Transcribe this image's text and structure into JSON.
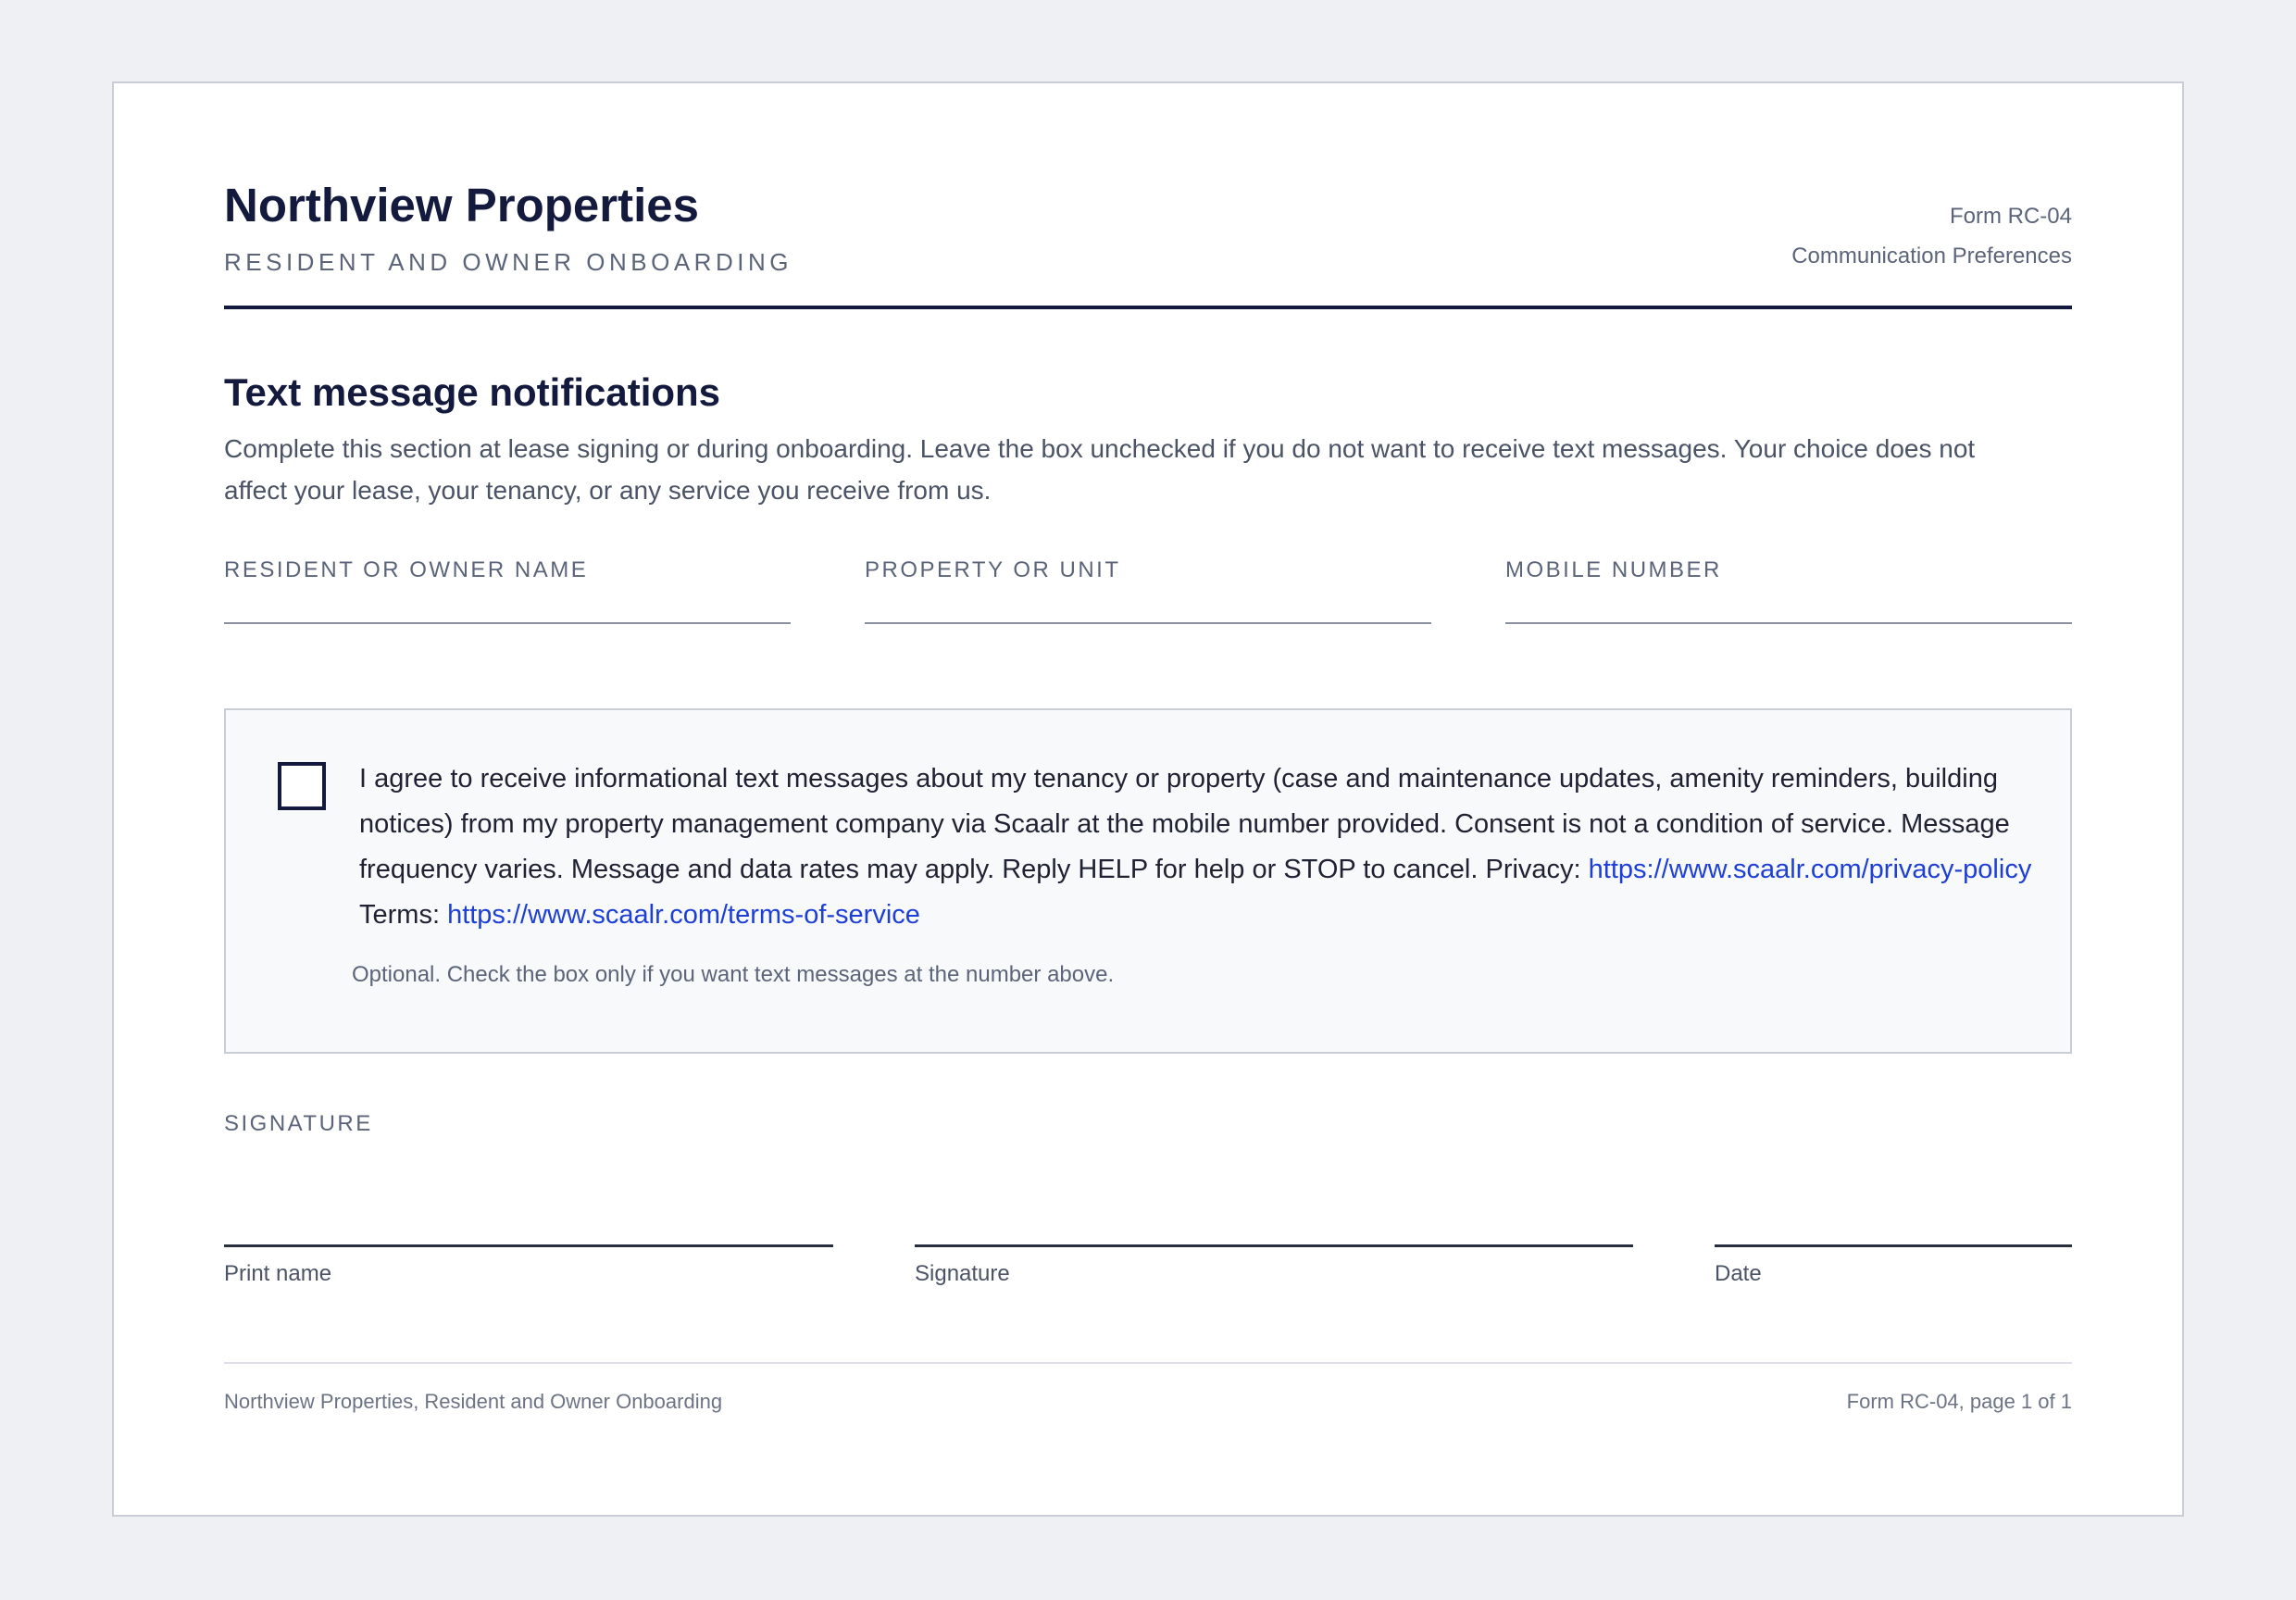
{
  "header": {
    "company": "Northview Properties",
    "subtitle": "RESIDENT AND OWNER ONBOARDING",
    "form_id": "Form RC-04",
    "form_description": "Communication Preferences"
  },
  "section": {
    "title": "Text message notifications",
    "description": "Complete this section at lease signing or during onboarding. Leave the box unchecked if you do not want to receive text messages. Your choice does not affect your lease, your tenancy, or any service you receive from us."
  },
  "fields": [
    {
      "label": "RESIDENT OR OWNER NAME",
      "value": ""
    },
    {
      "label": "PROPERTY OR UNIT",
      "value": ""
    },
    {
      "label": "MOBILE NUMBER",
      "value": ""
    }
  ],
  "consent": {
    "checked": false,
    "text_part1": "I agree to receive informational text messages about my tenancy or property (case and maintenance updates, amenity reminders, building notices) from my property management company via Scaalr at the mobile number provided. Consent is not a condition of service. Message frequency varies. Message and data rates may apply. Reply HELP for help or STOP to cancel. Privacy: ",
    "privacy_link": "https://www.scaalr.com/privacy-policy",
    "terms_label": " Terms: ",
    "terms_link": "https://www.scaalr.com/terms-of-service",
    "hint": "Optional. Check the box only if you want text messages at the number above."
  },
  "signature": {
    "heading": "SIGNATURE",
    "print_name_label": "Print name",
    "signature_label": "Signature",
    "date_label": "Date"
  },
  "footer": {
    "left": "Northview Properties, Resident and Owner Onboarding",
    "right": "Form RC-04, page 1 of 1"
  },
  "colors": {
    "navy": "#141a3d",
    "link": "#1d3fd6",
    "muted": "#5b6479",
    "background": "#eef0f4"
  }
}
